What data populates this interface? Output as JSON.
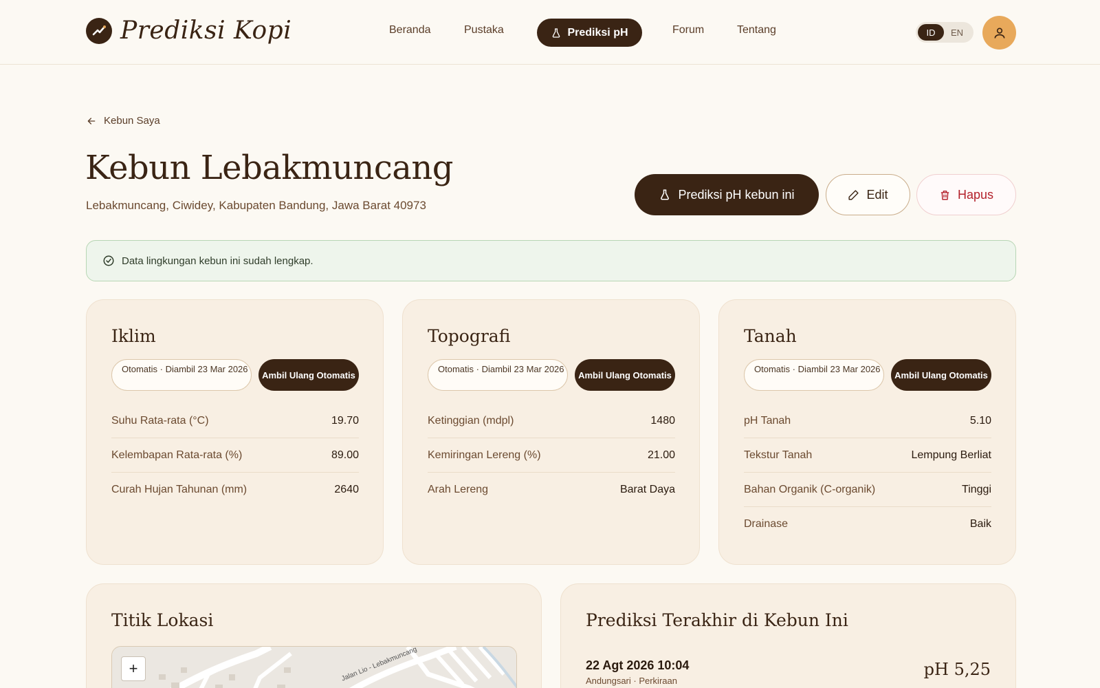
{
  "brand": {
    "name": "Prediksi Kopi"
  },
  "nav": {
    "items": [
      "Beranda",
      "Pustaka",
      "Prediksi pH",
      "Forum",
      "Tentang"
    ],
    "active": "Prediksi pH"
  },
  "lang": {
    "id": "ID",
    "en": "EN"
  },
  "page": {
    "back_label": "Kebun Saya",
    "title": "Kebun Lebakmuncang",
    "address": "Lebakmuncang, Ciwidey, Kabupaten Bandung, Jawa Barat 40973",
    "predict_button": "Prediksi pH kebun ini",
    "edit_button": "Edit",
    "delete_button": "Hapus",
    "alert": "Data lingkungan kebun ini sudah lengkap."
  },
  "cards": [
    {
      "title": "Iklim",
      "source": "Otomatis · Diambil 23 Mar 2026",
      "refetch": "Ambil Ulang Otomatis",
      "rows": [
        {
          "label": "Suhu Rata-rata (°C)",
          "value": "19.70"
        },
        {
          "label": "Kelembapan Rata-rata (%)",
          "value": "89.00"
        },
        {
          "label": "Curah Hujan Tahunan (mm)",
          "value": "2640"
        }
      ]
    },
    {
      "title": "Topografi",
      "source": "Otomatis · Diambil 23 Mar 2026",
      "refetch": "Ambil Ulang Otomatis",
      "rows": [
        {
          "label": "Ketinggian (mdpl)",
          "value": "1480"
        },
        {
          "label": "Kemiringan Lereng (%)",
          "value": "21.00"
        },
        {
          "label": "Arah Lereng",
          "value": "Barat Daya"
        }
      ]
    },
    {
      "title": "Tanah",
      "source": "Otomatis · Diambil 23 Mar 2026",
      "refetch": "Ambil Ulang Otomatis",
      "rows": [
        {
          "label": "pH Tanah",
          "value": "5.10"
        },
        {
          "label": "Tekstur Tanah",
          "value": "Lempung Berliat"
        },
        {
          "label": "Bahan Organik (C-organik)",
          "value": "Tinggi"
        },
        {
          "label": "Drainase",
          "value": "Baik"
        }
      ]
    }
  ],
  "location": {
    "title": "Titik Lokasi",
    "zoom_in": "+",
    "road_label": "Jalan Lio - Lebakmuncang"
  },
  "latest": {
    "title": "Prediksi Terakhir di Kebun Ini",
    "date": "22 Agt 2026 10:04",
    "meta": "Andungsari · Perkiraan",
    "value": "pH 5,25"
  }
}
